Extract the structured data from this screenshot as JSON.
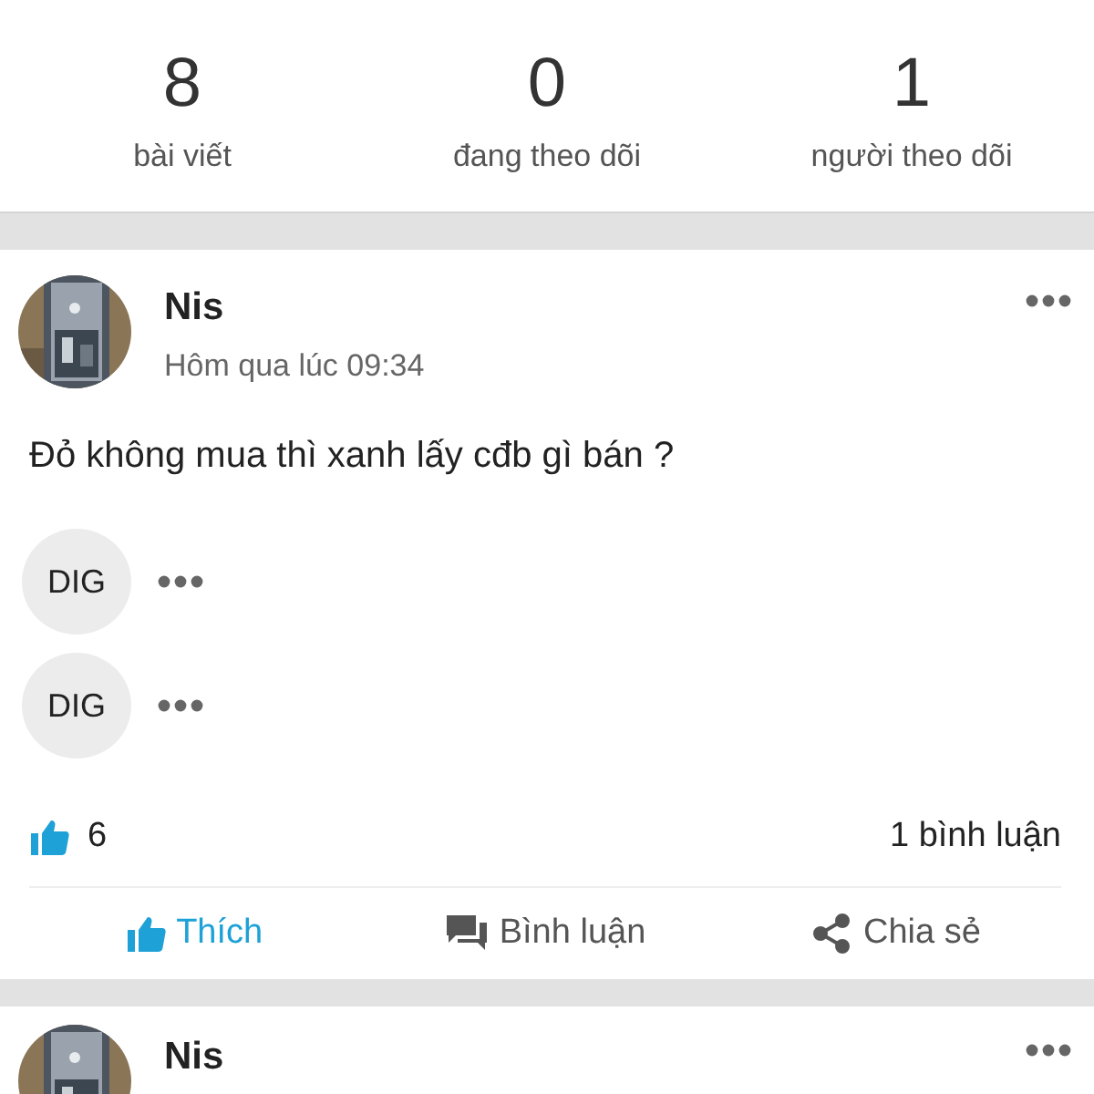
{
  "profile_stats": [
    {
      "value": "8",
      "label": "bài viết"
    },
    {
      "value": "0",
      "label": "đang theo dõi"
    },
    {
      "value": "1",
      "label": "người theo dõi"
    }
  ],
  "posts": [
    {
      "author": "Nis",
      "time": "Hôm qua lúc 09:34",
      "content": "Đỏ không mua thì xanh lấy cđb gì bán ?",
      "chips": [
        {
          "label": "DIG"
        },
        {
          "label": "DIG"
        }
      ],
      "like_count": "6",
      "comment_count": "1 bình luận",
      "liked": true,
      "actions": [
        {
          "kind": "like",
          "label": "Thích"
        },
        {
          "kind": "comment",
          "label": "Bình luận"
        },
        {
          "kind": "share",
          "label": "Chia sẻ"
        }
      ]
    },
    {
      "author": "Nis"
    }
  ]
}
